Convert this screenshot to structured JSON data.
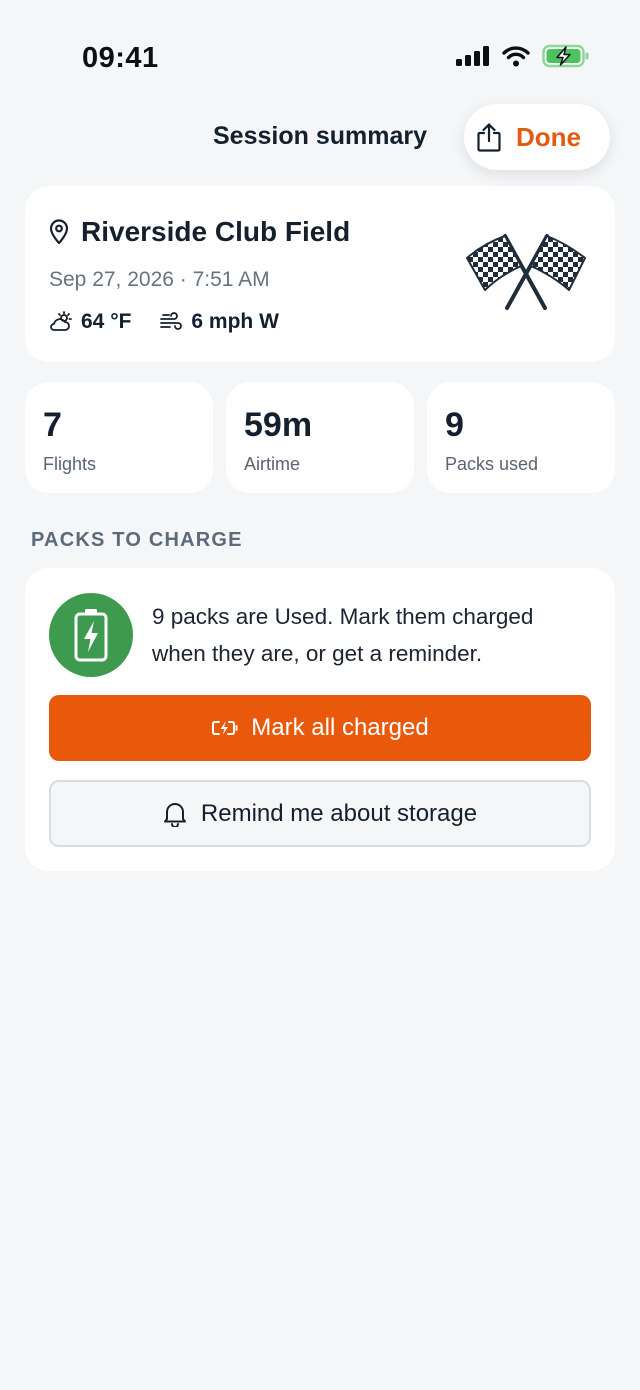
{
  "status_bar": {
    "time": "09:41"
  },
  "nav": {
    "title": "Session summary",
    "done_label": "Done"
  },
  "venue": {
    "name": "Riverside Club Field",
    "date": "Sep 27, 2026 · 7:51 AM",
    "temperature": "64 °F",
    "wind": "6 mph W"
  },
  "stats": [
    {
      "value": "7",
      "label": "Flights"
    },
    {
      "value": "59m",
      "label": "Airtime"
    },
    {
      "value": "9",
      "label": "Packs used"
    }
  ],
  "packs_section": {
    "header": "PACKS TO CHARGE",
    "message": "9 packs are Used. Mark them charged when they are, or get a reminder.",
    "primary_button": "Mark all charged",
    "secondary_button": "Remind me about storage"
  },
  "colors": {
    "accent": "#e8590c",
    "battery_green": "#3e9a4f",
    "background": "#f4f6f8"
  },
  "icons": [
    "pin-icon",
    "flags-icon",
    "weather-icon",
    "wind-icon",
    "share-icon",
    "battery-icon",
    "charging-icon",
    "bell-icon"
  ]
}
